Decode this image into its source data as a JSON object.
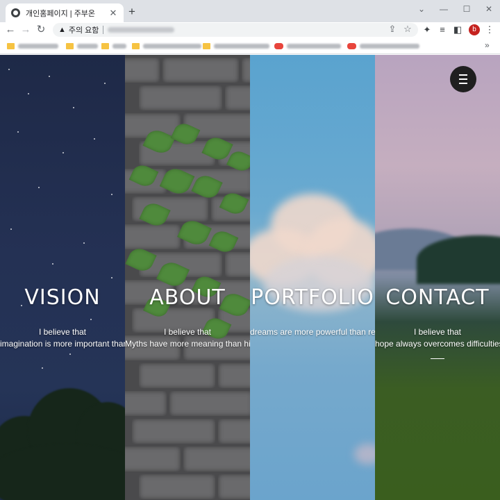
{
  "browser": {
    "tab_title": "개인홈페이지 | 주부온",
    "tab_close": "✕",
    "new_tab": "+",
    "security_label": "주의 요함",
    "profile_initial": "b",
    "bookmarks_more": "»",
    "controls": {
      "min": "—",
      "max": "☐",
      "close": "✕",
      "tabsearch": "⌄"
    }
  },
  "panels": [
    {
      "heading": "VISION",
      "line1": "I believe that",
      "line2": "imagination is more important than knowledge."
    },
    {
      "heading": "ABOUT",
      "line1": "I believe that",
      "line2": "Myths have more meaning than history."
    },
    {
      "heading": "PORTFOLIO",
      "line1": "",
      "line2": "dreams are more powerful than reality."
    },
    {
      "heading": "CONTACT",
      "line1": "I believe that",
      "line2": "hope always overcomes difficulties."
    }
  ]
}
